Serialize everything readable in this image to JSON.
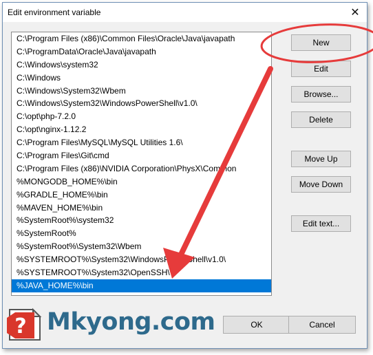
{
  "window": {
    "title": "Edit environment variable",
    "close_glyph": "✕"
  },
  "path_list": {
    "items": [
      "C:\\Program Files (x86)\\Common Files\\Oracle\\Java\\javapath",
      "C:\\ProgramData\\Oracle\\Java\\javapath",
      "C:\\Windows\\system32",
      "C:\\Windows",
      "C:\\Windows\\System32\\Wbem",
      "C:\\Windows\\System32\\WindowsPowerShell\\v1.0\\",
      "C:\\opt\\php-7.2.0",
      "C:\\opt\\nginx-1.12.2",
      "C:\\Program Files\\MySQL\\MySQL Utilities 1.6\\",
      "C:\\Program Files\\Git\\cmd",
      "C:\\Program Files (x86)\\NVIDIA Corporation\\PhysX\\Common",
      "%MONGODB_HOME%\\bin",
      "%GRADLE_HOME%\\bin",
      "%MAVEN_HOME%\\bin",
      "%SystemRoot%\\system32",
      "%SystemRoot%",
      "%SystemRoot%\\System32\\Wbem",
      "%SYSTEMROOT%\\System32\\WindowsPowerShell\\v1.0\\",
      "%SYSTEMROOT%\\System32\\OpenSSH\\",
      "%JAVA_HOME%\\bin"
    ],
    "selected_index": 19
  },
  "buttons": {
    "new": "New",
    "edit": "Edit",
    "browse": "Browse...",
    "delete": "Delete",
    "move_up": "Move Up",
    "move_down": "Move Down",
    "edit_text": "Edit text...",
    "ok": "OK",
    "cancel": "Cancel"
  },
  "annotation": {
    "color": "#e63b3b"
  },
  "watermark": {
    "text": "Mkyong.com",
    "icon_glyph": "?"
  },
  "colors": {
    "selection": "#0078d7",
    "logo_text": "#2e6a8c",
    "logo_icon": "#d9372b"
  }
}
